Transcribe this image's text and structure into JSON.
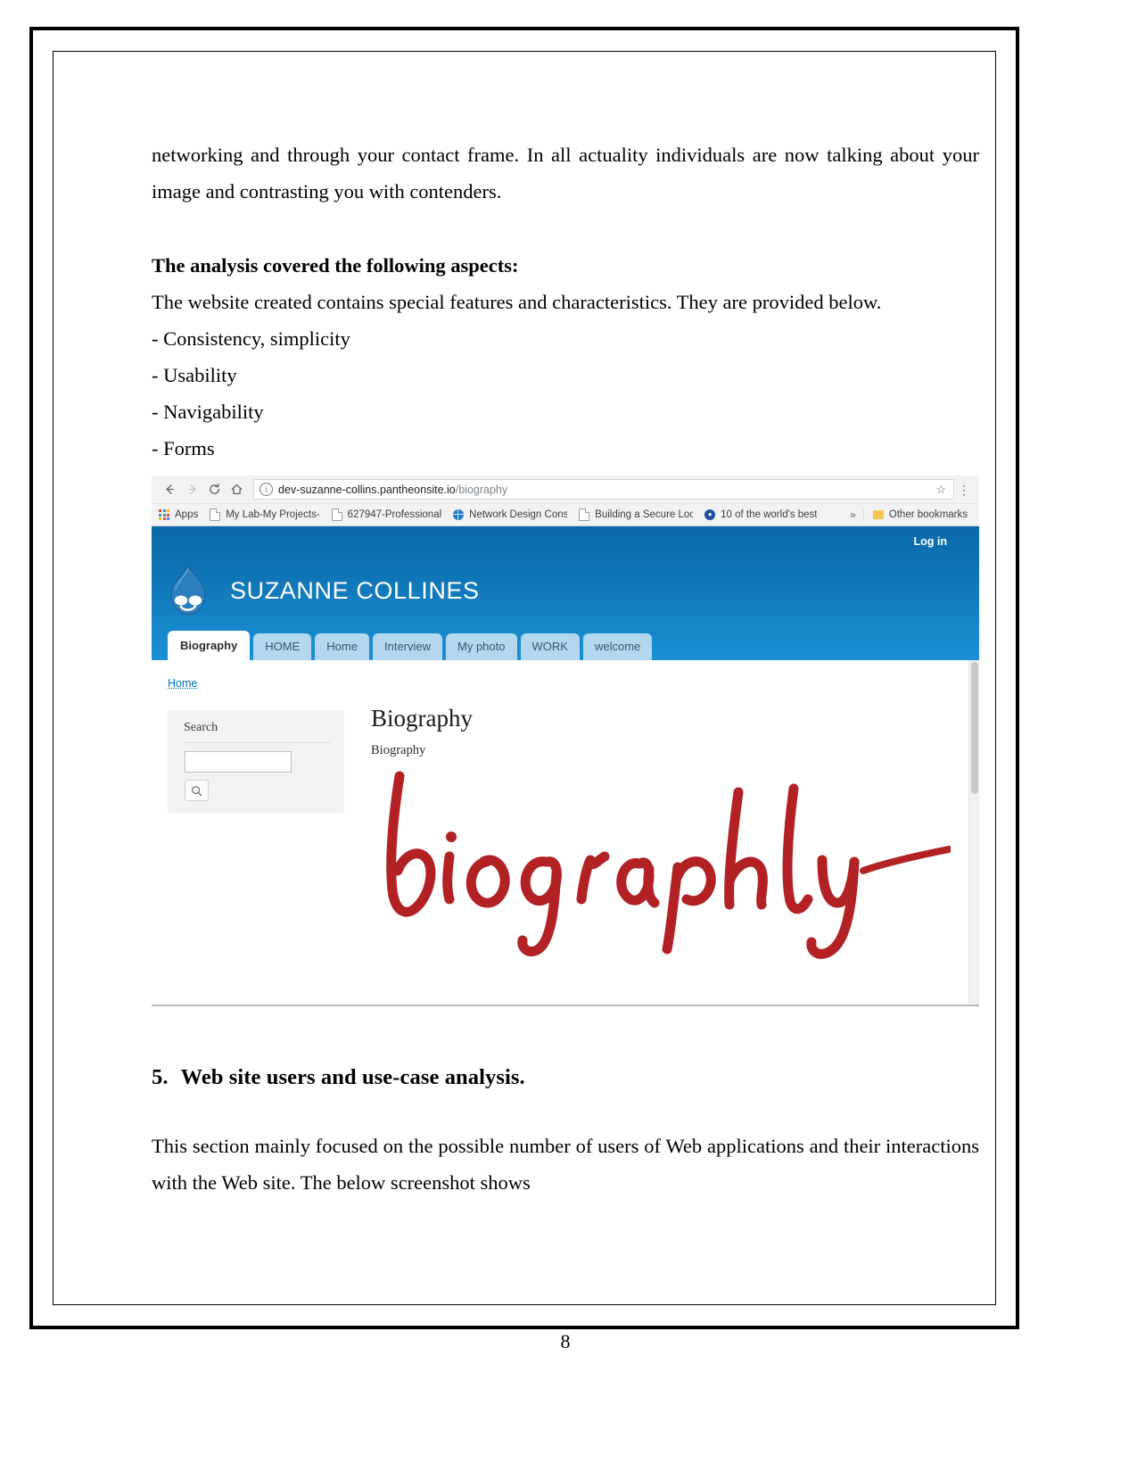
{
  "document": {
    "paragraph_1": "networking and through your contact frame. In all actuality individuals are now talking about your image and contrasting you with contenders.",
    "bold_heading": "The analysis covered the following aspects:",
    "intro_line": "The website created contains special features and characteristics. They are provided below.",
    "bullets": [
      "- Consistency, simplicity",
      "- Usability",
      "- Navigability",
      "- Forms"
    ],
    "section_number": "5.",
    "section_title": "Web site users and use-case analysis.",
    "paragraph_2": "This section mainly focused on the possible number of users of Web applications and their interactions with the Web site. The below screenshot shows",
    "page_number": "8"
  },
  "browser": {
    "nav": {
      "back_icon": "arrow-left-icon",
      "forward_icon": "arrow-right-icon",
      "reload_icon": "reload-icon",
      "home_icon": "home-icon"
    },
    "omnibox": {
      "info_icon": "info-icon",
      "url_host": "dev-suzanne-collins.pantheonsite.io",
      "url_path": "/biography",
      "full_url": "dev-suzanne-collins.pantheonsite.io/biography",
      "star_icon": "star-icon",
      "menu_icon": "three-dots-menu-icon"
    },
    "bookmarks": [
      {
        "label": "Apps",
        "icon": "apps-grid-icon"
      },
      {
        "label": "My Lab-My Projects-",
        "icon": "document-favicon"
      },
      {
        "label": "627947-Professional",
        "icon": "document-favicon"
      },
      {
        "label": "Network Design Cons",
        "icon": "globe-favicon"
      },
      {
        "label": "Building a Secure Loc",
        "icon": "document-favicon"
      },
      {
        "label": "10 of the world's best",
        "icon": "blue-circle-favicon"
      }
    ],
    "overflow_label": "»",
    "other_bookmarks": {
      "label": "Other bookmarks",
      "icon": "folder-icon"
    }
  },
  "site": {
    "login_label": "Log in",
    "logo_icon": "drupal-droplet-icon",
    "title": "SUZANNE COLLINES",
    "tabs": [
      {
        "label": "Biography",
        "active": true
      },
      {
        "label": "HOME",
        "active": false
      },
      {
        "label": "Home",
        "active": false
      },
      {
        "label": "Interview",
        "active": false
      },
      {
        "label": "My photo",
        "active": false
      },
      {
        "label": "WORK",
        "active": false
      },
      {
        "label": "welcome",
        "active": false
      }
    ],
    "breadcrumb": "Home",
    "sidebar": {
      "search_label": "Search",
      "search_value": "",
      "search_placeholder": "",
      "search_button_icon": "magnifier-icon"
    },
    "article": {
      "title": "Biography",
      "subtitle": "Biography",
      "image_text": "biography",
      "image_color": "#b22225"
    }
  },
  "colors": {
    "header_blue": "#0f74b4",
    "tab_inactive": "#b3d7ef",
    "link_blue": "#0071b3",
    "script_red": "#b22225"
  }
}
